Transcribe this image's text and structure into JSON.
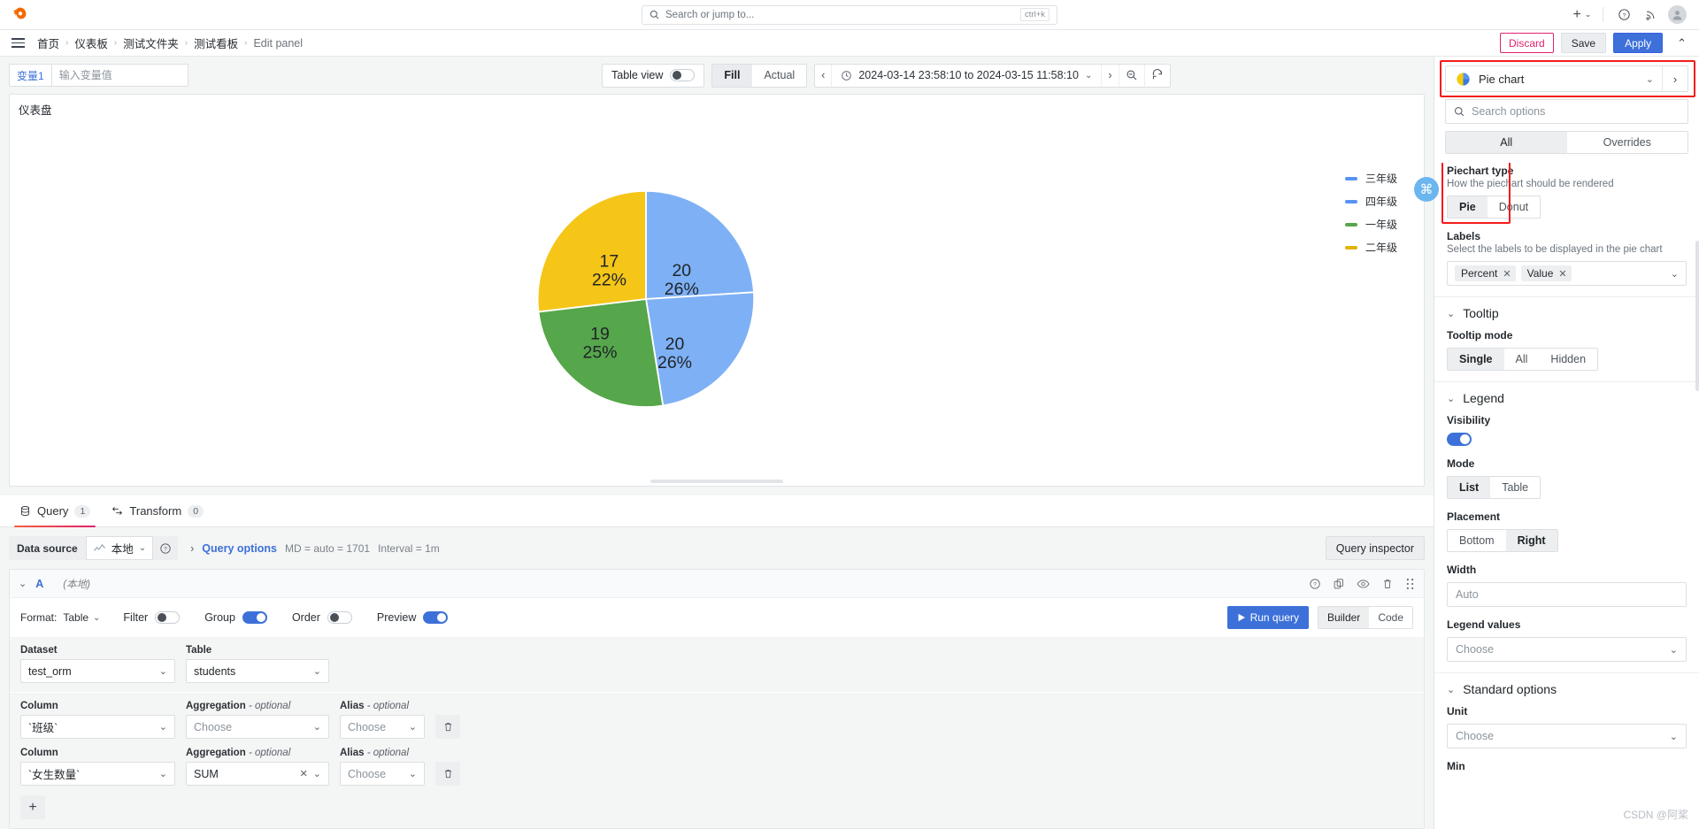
{
  "topbar": {
    "search_placeholder": "Search or jump to...",
    "shortcut": "ctrl+k",
    "plus_label": "+",
    "help_icon": "help-circle-icon",
    "news_icon": "rss-icon",
    "avatar_icon": "user-avatar-icon"
  },
  "breadcrumb": {
    "items": [
      {
        "label": "首页"
      },
      {
        "label": "仪表板"
      },
      {
        "label": "测试文件夹"
      },
      {
        "label": "测试看板"
      },
      {
        "label": "Edit panel"
      }
    ],
    "separator": "›",
    "discard_label": "Discard",
    "save_label": "Save",
    "apply_label": "Apply"
  },
  "toolbar": {
    "variable_label": "变量1",
    "variable_placeholder": "输入变量值",
    "variable_value": "",
    "table_view_label": "Table view",
    "table_view_on": false,
    "fill_label": "Fill",
    "actual_label": "Actual",
    "fill_active": true,
    "time_range": "2024-03-14 23:58:10 to 2024-03-15 11:58:10",
    "prev_icon": "chevron-left-icon",
    "next_icon": "chevron-right-icon",
    "zoom_out_icon": "zoom-out-icon",
    "refresh_icon": "refresh-icon"
  },
  "panel": {
    "title": "仪表盘"
  },
  "chart_data": {
    "type": "pie",
    "title": "仪表盘",
    "labels": [
      "三年级",
      "四年级",
      "一年级",
      "二年级"
    ],
    "values": [
      20,
      20,
      19,
      17
    ],
    "percents": [
      "26%",
      "26%",
      "25%",
      "22%"
    ],
    "colors": [
      "#7eb0f5",
      "#7eb0f5",
      "#56a64b",
      "#f2cc0c"
    ],
    "slice_display": [
      {
        "name": "三年级",
        "value": 20,
        "percent": "26%",
        "color": "#7eb0f5"
      },
      {
        "name": "四年级",
        "value": 20,
        "percent": "26%",
        "color": "#7eb0f5"
      },
      {
        "name": "一年级",
        "value": 19,
        "percent": "25%",
        "color": "#56a64b"
      },
      {
        "name": "二年级",
        "value": 17,
        "percent": "22%",
        "color": "#f2cc0c"
      }
    ],
    "legend": {
      "position": "right",
      "entries": [
        {
          "label": "三年级",
          "color": "#5794f2"
        },
        {
          "label": "四年级",
          "color": "#5794f2"
        },
        {
          "label": "一年级",
          "color": "#56a64b"
        },
        {
          "label": "二年级",
          "color": "#e0b400"
        }
      ]
    }
  },
  "query": {
    "tabs": [
      {
        "label": "Query",
        "count": "1",
        "icon": "database-icon"
      },
      {
        "label": "Transform",
        "count": "0",
        "icon": "transform-icon"
      }
    ],
    "data_source_label": "Data source",
    "data_source_value": "本地",
    "query_options_label": "Query options",
    "max_data_points": "MD = auto = 1701",
    "interval": "Interval = 1m",
    "query_inspector_label": "Query inspector",
    "card": {
      "ref_id": "A",
      "data_source": "(本地)",
      "format_label": "Format:",
      "format_value": "Table",
      "filter_label": "Filter",
      "filter_on": false,
      "group_label": "Group",
      "group_on": true,
      "order_label": "Order",
      "order_on": false,
      "preview_label": "Preview",
      "preview_on": true,
      "run_query_label": "Run query",
      "builder_label": "Builder",
      "code_label": "Code",
      "builder_active": true,
      "dataset_label": "Dataset",
      "dataset_value": "test_orm",
      "table_label": "Table",
      "table_value": "students",
      "column_label": "Column",
      "aggregation_label": "Aggregation",
      "aggregation_optional": "- optional",
      "alias_label": "Alias",
      "alias_optional": "- optional",
      "rows": [
        {
          "column": "`班级`",
          "aggregation": "Choose",
          "aggregation_set": false,
          "alias": "Choose"
        },
        {
          "column": "`女生数量`",
          "aggregation": "SUM",
          "aggregation_set": true,
          "alias": "Choose"
        }
      ],
      "add_label": "+"
    }
  },
  "options": {
    "viz_name": "Pie chart",
    "search_placeholder": "Search options",
    "tab_all": "All",
    "tab_overrides": "Overrides",
    "piechart": {
      "label": "Piechart type",
      "desc": "How the piechart should be rendered",
      "pie": "Pie",
      "donut": "Donut",
      "selected": "Pie"
    },
    "labels": {
      "label": "Labels",
      "desc": "Select the labels to be displayed in the pie chart",
      "chips": [
        "Percent",
        "Value"
      ]
    },
    "tooltip": {
      "section": "Tooltip",
      "mode_label": "Tooltip mode",
      "modes": [
        "Single",
        "All",
        "Hidden"
      ],
      "selected": "Single"
    },
    "legend": {
      "section": "Legend",
      "visibility_label": "Visibility",
      "visibility_on": true,
      "mode_label": "Mode",
      "modes": [
        "List",
        "Table"
      ],
      "mode_selected": "List",
      "placement_label": "Placement",
      "placements": [
        "Bottom",
        "Right"
      ],
      "placement_selected": "Right",
      "width_label": "Width",
      "width_placeholder": "Auto",
      "values_label": "Legend values",
      "values_placeholder": "Choose"
    },
    "standard": {
      "section": "Standard options",
      "unit_label": "Unit",
      "unit_placeholder": "Choose",
      "min_label": "Min"
    }
  },
  "watermark": "CSDN @阿桨"
}
